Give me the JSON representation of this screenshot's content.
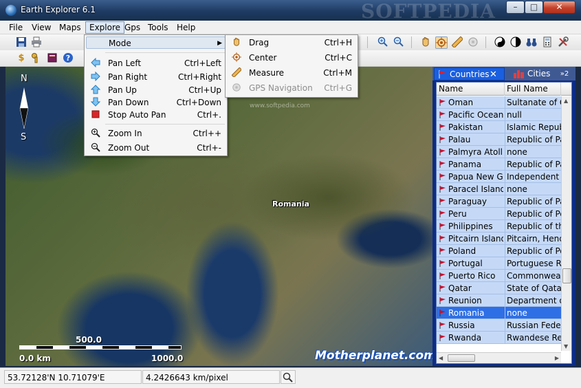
{
  "window": {
    "title": "Earth Explorer 6.1",
    "watermark": "SOFTPEDIA"
  },
  "window_controls": {
    "minimize": "–",
    "maximize": "□",
    "close": "✕"
  },
  "menubar": {
    "items": [
      "File",
      "View",
      "Maps",
      "Explore",
      "Gps",
      "Tools",
      "Help"
    ],
    "active": "Explore"
  },
  "explore_menu": {
    "items": [
      {
        "label": "Mode",
        "shortcut": "",
        "icon": ""
      },
      {
        "label": "Pan Left",
        "shortcut": "Ctrl+Left",
        "icon": "arrow-left-icon"
      },
      {
        "label": "Pan Right",
        "shortcut": "Ctrl+Right",
        "icon": "arrow-right-icon"
      },
      {
        "label": "Pan Up",
        "shortcut": "Ctrl+Up",
        "icon": "arrow-up-icon"
      },
      {
        "label": "Pan Down",
        "shortcut": "Ctrl+Down",
        "icon": "arrow-down-icon"
      },
      {
        "label": "Stop Auto Pan",
        "shortcut": "Ctrl+.",
        "icon": "stop-icon"
      },
      {
        "label": "Zoom In",
        "shortcut": "Ctrl++",
        "icon": "zoom-in-icon"
      },
      {
        "label": "Zoom Out",
        "shortcut": "Ctrl+-",
        "icon": "zoom-out-icon"
      }
    ]
  },
  "mode_menu": {
    "items": [
      {
        "label": "Drag",
        "shortcut": "Ctrl+H",
        "icon": "hand-icon"
      },
      {
        "label": "Center",
        "shortcut": "Ctrl+C",
        "icon": "target-icon"
      },
      {
        "label": "Measure",
        "shortcut": "Ctrl+M",
        "icon": "ruler-icon"
      },
      {
        "label": "GPS Navigation",
        "shortcut": "Ctrl+G",
        "icon": "gps-icon"
      }
    ]
  },
  "map": {
    "label": "Romania",
    "softpedia_mark": "www.softpedia.com",
    "compass_n": "N",
    "compass_s": "S",
    "scale_mid": "500.0",
    "scale_start": "0.0 km",
    "scale_end": "1000.0",
    "brand": "Motherplanet.com"
  },
  "panel": {
    "tab_countries": "Countries",
    "tab_close": "✕",
    "tab_cities": "Cities",
    "tab_more": "»2",
    "header_name": "Name",
    "header_full": "Full Name",
    "rows": [
      {
        "name": "Oman",
        "full": "Sultanate of Oman"
      },
      {
        "name": "Pacific Ocean",
        "full": "null"
      },
      {
        "name": "Pakistan",
        "full": "Islamic Republic"
      },
      {
        "name": "Palau",
        "full": "Republic of Palau"
      },
      {
        "name": "Palmyra Atoll",
        "full": "none"
      },
      {
        "name": "Panama",
        "full": "Republic of Panama"
      },
      {
        "name": "Papua New G...",
        "full": "Independent State"
      },
      {
        "name": "Paracel Islands",
        "full": "none"
      },
      {
        "name": "Paraguay",
        "full": "Republic of Paraguay"
      },
      {
        "name": "Peru",
        "full": "Republic of Peru"
      },
      {
        "name": "Philippines",
        "full": "Republic of the"
      },
      {
        "name": "Pitcairn Islands",
        "full": "Pitcairn, Henderson"
      },
      {
        "name": "Poland",
        "full": "Republic of Poland"
      },
      {
        "name": "Portugal",
        "full": "Portuguese Republic"
      },
      {
        "name": "Puerto Rico",
        "full": "Commonwealth"
      },
      {
        "name": "Qatar",
        "full": "State of Qatar"
      },
      {
        "name": "Reunion",
        "full": "Department of"
      },
      {
        "name": "Romania",
        "full": "none"
      },
      {
        "name": "Russia",
        "full": "Russian Federation"
      },
      {
        "name": "Rwanda",
        "full": "Rwandese Republic"
      }
    ],
    "selected": "Romania"
  },
  "status": {
    "coords": "53.72128'N 10.71079'E",
    "scale": "4.2426643 km/pixel"
  },
  "colors": {
    "selection": "#2f6fe6",
    "row_bg": "#c5d9f7",
    "panel_bg": "#0d2c86",
    "flag": "#c8102e"
  }
}
